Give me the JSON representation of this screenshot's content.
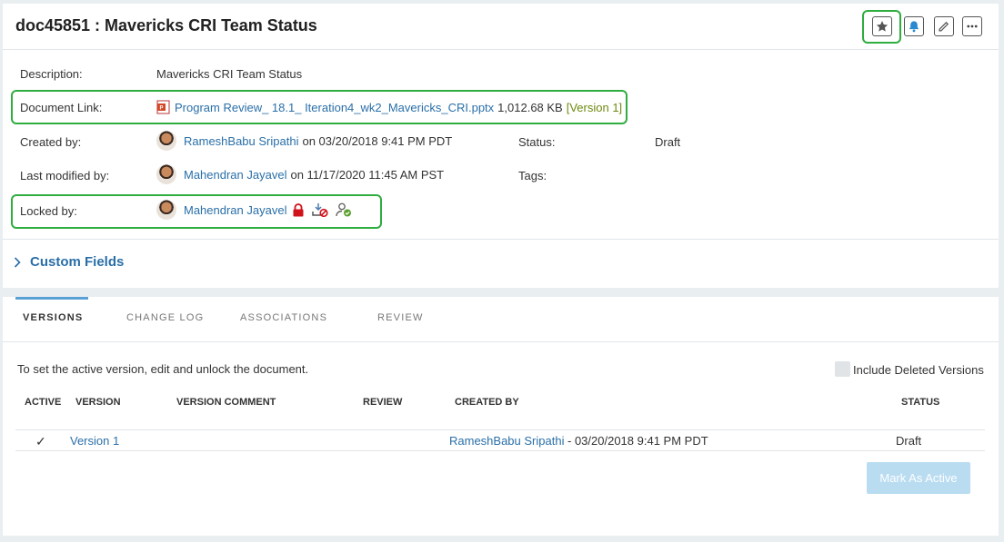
{
  "header": {
    "title": "doc45851 : Mavericks CRI Team Status",
    "actions": [
      "star-icon",
      "bell-icon",
      "pencil-icon",
      "more-icon"
    ]
  },
  "details": {
    "description_label": "Description:",
    "description_value": "Mavericks CRI Team Status",
    "doc_link_label": "Document Link:",
    "doc_link_name": "Program Review_ 18.1_ Iteration4_wk2_Mavericks_CRI.pptx",
    "doc_link_size": "1,012.68 KB",
    "doc_link_version": "[Version 1]",
    "created_label": "Created by:",
    "created_user": "RameshBabu Sripathi",
    "created_date": "on 03/20/2018 9:41 PM PDT",
    "status_label": "Status:",
    "status_value": "Draft",
    "modified_label": "Last modified by:",
    "modified_user": "Mahendran Jayavel",
    "modified_date": "on 11/17/2020 11:45 AM PST",
    "tags_label": "Tags:",
    "locked_label": "Locked by:",
    "locked_user": "Mahendran Jayavel"
  },
  "custom_fields": {
    "label": "Custom Fields"
  },
  "tabs": [
    {
      "label": "VERSIONS"
    },
    {
      "label": "CHANGE LOG"
    },
    {
      "label": "ASSOCIATIONS"
    },
    {
      "label": "REVIEW"
    }
  ],
  "versions": {
    "instruction": "To set the active version, edit and unlock the document.",
    "include_deleted_label": "Include Deleted Versions",
    "columns": [
      "ACTIVE",
      "VERSION",
      "VERSION COMMENT",
      "REVIEW",
      "CREATED BY",
      "STATUS"
    ],
    "rows": [
      {
        "active": "✓",
        "version": "Version 1",
        "comment": "",
        "review": "",
        "created_by": "RameshBabu Sripathi",
        "created_date": "- 03/20/2018 9:41 PM PDT",
        "status": "Draft"
      }
    ],
    "mark_active_label": "Mark As Active"
  },
  "colors": {
    "accent": "#2a6fa8",
    "highlight": "#2fad3f",
    "version_green": "#6d8a10",
    "button_disabled": "#b9dcf1"
  }
}
